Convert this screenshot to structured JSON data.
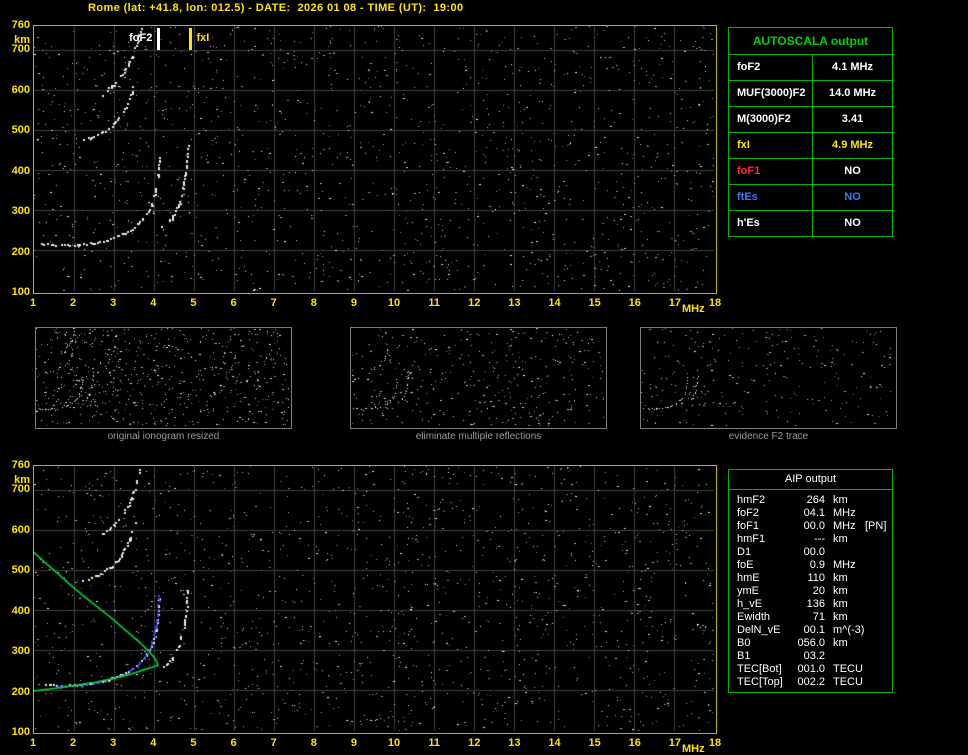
{
  "header": {
    "title": "Rome (lat: +41.8, lon: 012.5) - DATE:  2026 01 08 - TIME (UT):  19:00"
  },
  "top_plot": {
    "markers": [
      {
        "label": "foF2",
        "freq_mhz": 4.1,
        "color": "#ffffff",
        "side": "left"
      },
      {
        "label": "fxI",
        "freq_mhz": 4.9,
        "color": "#ffe400",
        "side": "right"
      }
    ]
  },
  "autoscala": {
    "title": "AUTOSCALA output",
    "border_color": "#00b400",
    "rows": [
      {
        "label": "foF2",
        "value": "4.1 MHz",
        "label_color": "#ffffff",
        "value_color": "#ffffff"
      },
      {
        "label": "MUF(3000)F2",
        "value": "14.0 MHz",
        "label_color": "#ffffff",
        "value_color": "#ffffff"
      },
      {
        "label": "M(3000)F2",
        "value": "3.41",
        "label_color": "#ffffff",
        "value_color": "#ffffff"
      },
      {
        "label": "fxI",
        "value": "4.9 MHz",
        "label_color": "#ffe400",
        "value_color": "#ffe400"
      },
      {
        "label": "foF1",
        "value": "NO",
        "label_color": "#ff3232",
        "value_color": "#ffffff"
      },
      {
        "label": "ftEs",
        "value": "NO",
        "label_color": "#3c78ff",
        "value_color": "#3c78ff"
      },
      {
        "label": "h'Es",
        "value": "NO",
        "label_color": "#ffffff",
        "value_color": "#ffffff"
      }
    ]
  },
  "thumbnails": [
    {
      "caption": "original ionogram resized"
    },
    {
      "caption": "eliminate multiple reflections"
    },
    {
      "caption": "evidence F2 trace"
    }
  ],
  "aip": {
    "title": "AIP output",
    "rows": [
      {
        "label": "hmF2",
        "value": "264",
        "unit": "km",
        "note": ""
      },
      {
        "label": "foF2",
        "value": "04.1",
        "unit": "MHz",
        "note": ""
      },
      {
        "label": "foF1",
        "value": "00.0",
        "unit": "MHz",
        "note": "[PN]"
      },
      {
        "label": "hmF1",
        "value": "---",
        "unit": "km",
        "note": ""
      },
      {
        "label": "D1",
        "value": "00.0",
        "unit": "",
        "note": ""
      },
      {
        "label": "foE",
        "value": "0.9",
        "unit": "MHz",
        "note": ""
      },
      {
        "label": "hmE",
        "value": "110",
        "unit": "km",
        "note": ""
      },
      {
        "label": "ymE",
        "value": "20",
        "unit": "km",
        "note": ""
      },
      {
        "label": "h_vE",
        "value": "136",
        "unit": "km",
        "note": ""
      },
      {
        "label": "Ewidth",
        "value": "71",
        "unit": "km",
        "note": ""
      },
      {
        "label": "DelN_vE",
        "value": "00.1",
        "unit": "m^(-3)",
        "note": ""
      },
      {
        "label": "B0",
        "value": "056.0",
        "unit": "km",
        "note": ""
      },
      {
        "label": "B1",
        "value": "03.2",
        "unit": "",
        "note": ""
      },
      {
        "label": "TEC[Bot]",
        "value": "001.0",
        "unit": "TECU",
        "note": ""
      },
      {
        "label": "TEC[Top]",
        "value": "002.2",
        "unit": "TECU",
        "note": ""
      }
    ]
  },
  "chart_data": {
    "type": "scatter",
    "title": "Ionogram: virtual height (km) vs sounding frequency (MHz)",
    "xlabel": "MHz",
    "ylabel": "km",
    "x_range": [
      1,
      18
    ],
    "y_range": [
      100,
      760
    ],
    "x_ticks": [
      1,
      2,
      3,
      4,
      5,
      6,
      7,
      8,
      9,
      10,
      11,
      12,
      13,
      14,
      15,
      16,
      17,
      18
    ],
    "y_ticks": [
      760,
      700,
      600,
      500,
      400,
      300,
      200,
      100
    ],
    "grid": true,
    "scaled_values": {
      "foF2_MHz": 4.1,
      "MUF3000F2_MHz": 14.0,
      "M3000F2": 3.41,
      "fxI_MHz": 4.9,
      "hmF2_km": 264
    },
    "traces": {
      "f2_o_mode": [
        [
          1.2,
          218
        ],
        [
          1.6,
          214
        ],
        [
          2.0,
          214
        ],
        [
          2.4,
          218
        ],
        [
          2.8,
          226
        ],
        [
          3.1,
          237
        ],
        [
          3.4,
          251
        ],
        [
          3.6,
          267
        ],
        [
          3.8,
          289
        ],
        [
          3.95,
          314
        ],
        [
          4.05,
          348
        ],
        [
          4.1,
          388
        ],
        [
          4.13,
          432
        ]
      ],
      "f2_x_mode": [
        [
          4.2,
          258
        ],
        [
          4.45,
          281
        ],
        [
          4.62,
          314
        ],
        [
          4.74,
          358
        ],
        [
          4.82,
          416
        ],
        [
          4.86,
          468
        ]
      ],
      "second_hop": [
        [
          2.2,
          474
        ],
        [
          2.6,
          488
        ],
        [
          2.95,
          510
        ],
        [
          3.2,
          540
        ],
        [
          3.4,
          578
        ],
        [
          3.52,
          618
        ]
      ],
      "third_hop": [
        [
          2.7,
          590
        ],
        [
          3.0,
          614
        ],
        [
          3.25,
          645
        ],
        [
          3.45,
          680
        ],
        [
          3.58,
          718
        ],
        [
          3.66,
          752
        ]
      ],
      "fitted_f2_trace": [
        [
          1.4,
          212
        ],
        [
          1.8,
          211
        ],
        [
          2.2,
          214
        ],
        [
          2.6,
          220
        ],
        [
          3.0,
          230
        ],
        [
          3.3,
          243
        ],
        [
          3.6,
          262
        ],
        [
          3.8,
          287
        ],
        [
          3.95,
          318
        ],
        [
          4.05,
          358
        ],
        [
          4.1,
          402
        ],
        [
          4.12,
          440
        ]
      ],
      "electron_density_profile": [
        [
          1.0,
          200
        ],
        [
          1.5,
          206
        ],
        [
          2.0,
          213
        ],
        [
          2.5,
          221
        ],
        [
          3.0,
          231
        ],
        [
          3.4,
          241
        ],
        [
          3.7,
          251
        ],
        [
          3.95,
          259
        ],
        [
          4.1,
          264
        ],
        [
          4.05,
          277
        ],
        [
          3.9,
          296
        ],
        [
          3.65,
          320
        ],
        [
          3.3,
          350
        ],
        [
          2.9,
          384
        ],
        [
          2.45,
          420
        ],
        [
          2.0,
          456
        ],
        [
          1.6,
          492
        ],
        [
          1.25,
          522
        ],
        [
          1.0,
          545
        ]
      ]
    },
    "trace_colors": {
      "echo": "#ebebeb",
      "fitted_f2_trace": "#4646ff",
      "electron_density_profile": "#00d23c"
    },
    "panels": {
      "top": {
        "echo_traces": [
          "f2_o_mode",
          "f2_x_mode",
          "second_hop",
          "third_hop"
        ],
        "noise_dots": 1500,
        "seed": 11,
        "grid": true
      },
      "bottom": {
        "echo_traces": [
          "f2_o_mode",
          "f2_x_mode",
          "second_hop",
          "third_hop"
        ],
        "overlay_traces": [
          "fitted_f2_trace",
          "electron_density_profile"
        ],
        "noise_dots": 1500,
        "seed": 29,
        "grid": true
      },
      "thumb1": {
        "echo_traces": [
          "f2_o_mode",
          "f2_x_mode",
          "second_hop",
          "third_hop"
        ],
        "noise_dots": 650,
        "seed": 3,
        "grid": false
      },
      "thumb2": {
        "echo_traces": [
          "f2_o_mode",
          "f2_x_mode",
          "second_hop"
        ],
        "noise_dots": 380,
        "seed": 4,
        "grid": false
      },
      "thumb3": {
        "echo_traces": [
          "f2_o_mode",
          "f2_x_mode"
        ],
        "noise_dots": 260,
        "seed": 5,
        "grid": false
      }
    }
  }
}
